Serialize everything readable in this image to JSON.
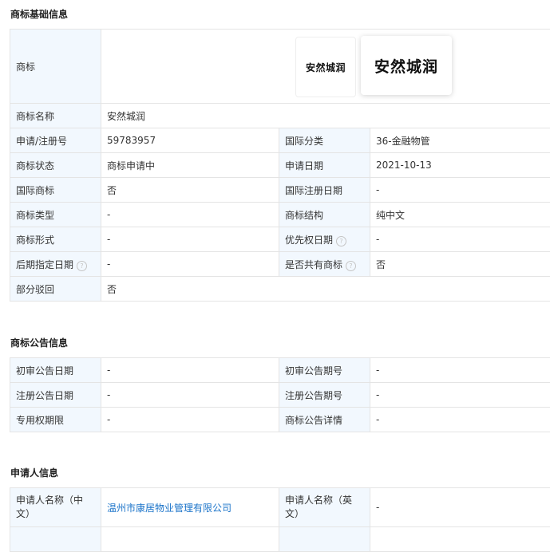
{
  "basic": {
    "title": "商标基础信息",
    "trademark_label": "商标",
    "trademark_image_text": "安然城润",
    "rows": [
      {
        "l1": "商标名称",
        "v1": "安然城润"
      },
      {
        "l1": "申请/注册号",
        "v1": "59783957",
        "l2": "国际分类",
        "v2": "36-金融物管"
      },
      {
        "l1": "商标状态",
        "v1": "商标申请中",
        "l2": "申请日期",
        "v2": "2021-10-13"
      },
      {
        "l1": "国际商标",
        "v1": "否",
        "l2": "国际注册日期",
        "v2": "-"
      },
      {
        "l1": "商标类型",
        "v1": "-",
        "l2": "商标结构",
        "v2": "纯中文"
      },
      {
        "l1": "商标形式",
        "v1": "-",
        "l2": "优先权日期",
        "v2": "-"
      },
      {
        "l1": "后期指定日期",
        "v1": "-",
        "l2": "是否共有商标",
        "v2": "否"
      },
      {
        "l1": "部分驳回",
        "v1": "否"
      }
    ]
  },
  "notice": {
    "title": "商标公告信息",
    "rows": [
      {
        "l1": "初审公告日期",
        "v1": "-",
        "l2": "初审公告期号",
        "v2": "-"
      },
      {
        "l1": "注册公告日期",
        "v1": "-",
        "l2": "注册公告期号",
        "v2": "-"
      },
      {
        "l1": "专用权期限",
        "v1": "-",
        "l2": "商标公告详情",
        "v2": "-"
      }
    ]
  },
  "applicant": {
    "title": "申请人信息",
    "rows": [
      {
        "l1": "申请人名称（中文）",
        "v1": "温州市康居物业管理有限公司",
        "l2": "申请人名称（英文）",
        "v2": "-"
      }
    ]
  },
  "colors": {
    "label_bg": "#f2f8fe",
    "border": "#e4e4e4",
    "link": "#1a73c9"
  }
}
